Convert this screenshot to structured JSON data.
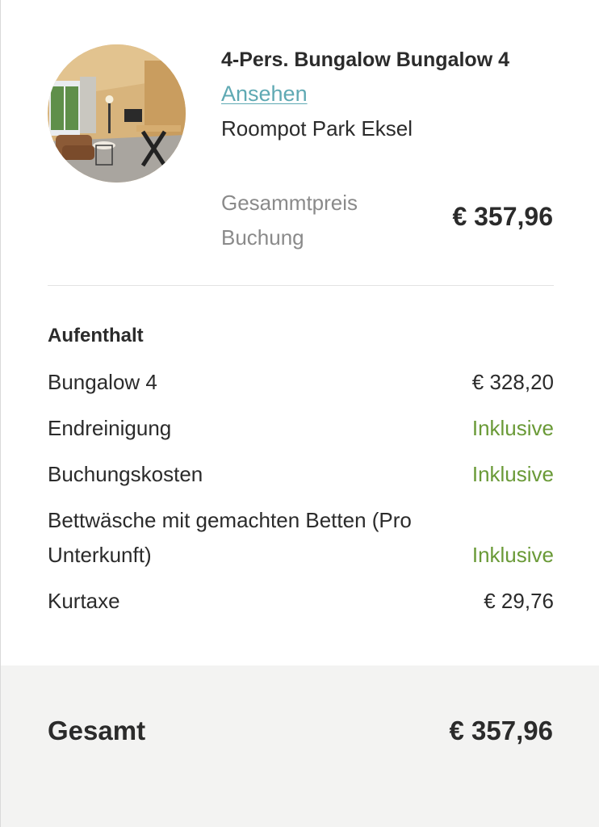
{
  "property": {
    "title": "4-Pers. Bungalow Bungalow 4",
    "view_link": "Ansehen",
    "park": "Roompot Park Eksel",
    "total_label_line1": "Gesammtpreis",
    "total_label_line2": "Buchung",
    "total_price": "€ 357,96",
    "image_icon": "bungalow-interior-photo"
  },
  "stay": {
    "title": "Aufenthalt",
    "items": [
      {
        "label": "Bungalow 4",
        "value": "€ 328,20"
      },
      {
        "label": "Endreinigung",
        "value": "Inklusive"
      },
      {
        "label": "Buchungskosten",
        "value": "Inklusive"
      },
      {
        "label": "Bettwäsche mit gemachten Betten (Pro Unterkunft)",
        "value": "Inklusive"
      },
      {
        "label": "Kurtaxe",
        "value": "€ 29,76"
      }
    ]
  },
  "total": {
    "label": "Gesamt",
    "value": "€ 357,96"
  },
  "colors": {
    "link": "#5fa9b3",
    "included": "#6a9a37",
    "footer_bg": "#f3f3f2",
    "text": "#2b2b2b",
    "muted": "#8a8a8a"
  }
}
